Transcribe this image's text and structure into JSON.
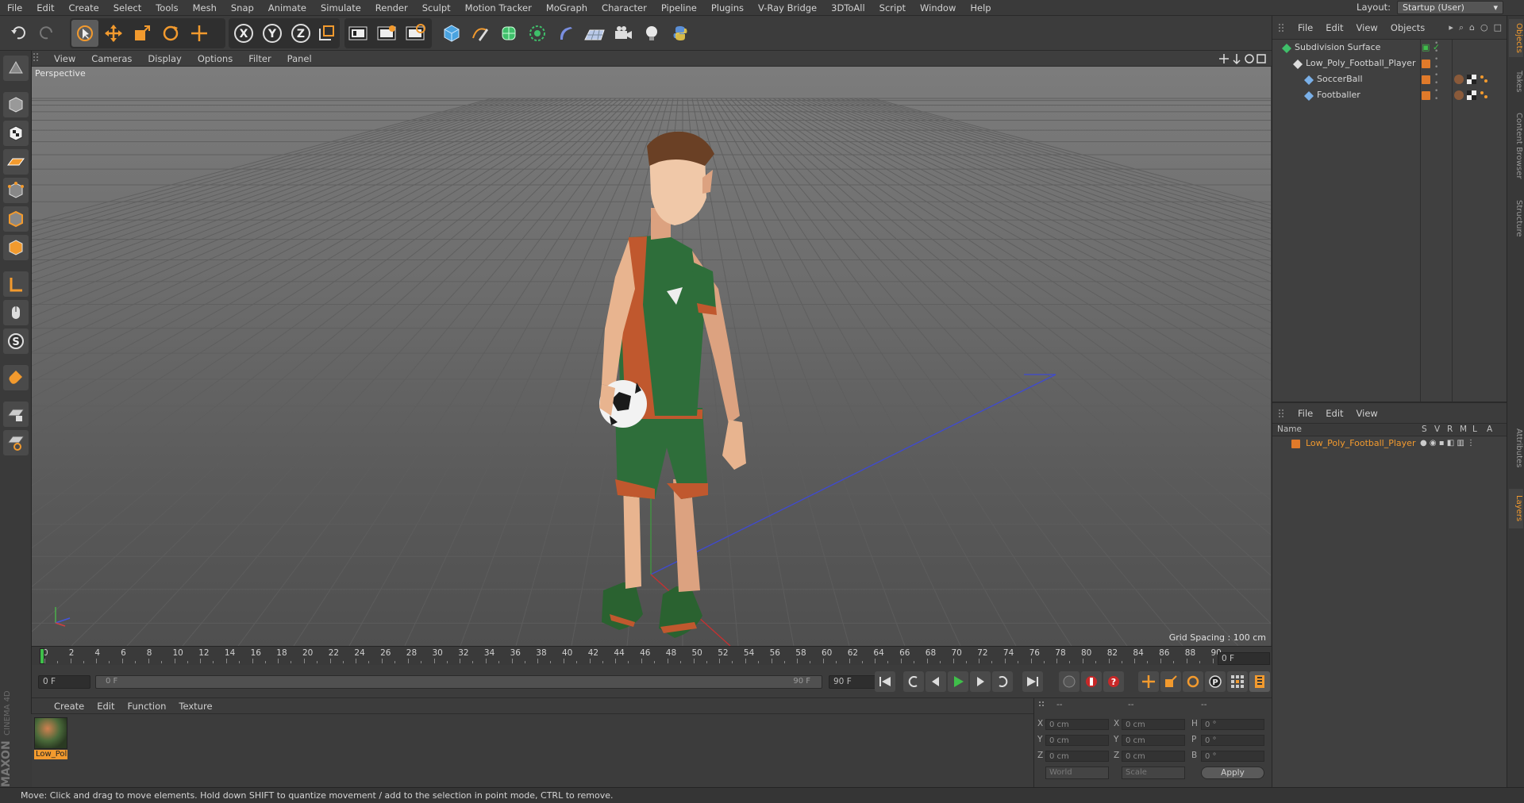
{
  "menubar": {
    "items": [
      "File",
      "Edit",
      "Create",
      "Select",
      "Tools",
      "Mesh",
      "Snap",
      "Animate",
      "Simulate",
      "Render",
      "Sculpt",
      "Motion Tracker",
      "MoGraph",
      "Character",
      "Pipeline",
      "Plugins",
      "V-Ray Bridge",
      "3DToAll",
      "Script",
      "Window",
      "Help"
    ],
    "layout_label": "Layout:",
    "layout_value": "Startup (User)"
  },
  "toolbar": {
    "icons": [
      "undo-icon",
      "redo-icon",
      "live-select-icon",
      "move-icon",
      "scale-icon",
      "rotate-icon",
      "recent-tool-icon",
      "x-axis-icon",
      "y-axis-icon",
      "z-axis-icon",
      "coordinate-system-icon",
      "render-view-icon",
      "render-picture-viewer-icon",
      "edit-render-settings-icon",
      "cube-icon",
      "pen-spline-icon",
      "subdivision-icon",
      "array-icon",
      "deformer-icon",
      "floor-icon",
      "camera-icon",
      "light-icon",
      "python-icon"
    ],
    "axis_labels": [
      "X",
      "Y",
      "Z"
    ]
  },
  "viewport": {
    "menu": [
      "View",
      "Cameras",
      "Display",
      "Options",
      "Filter",
      "Panel"
    ],
    "label": "Perspective",
    "grid_spacing": "Grid Spacing : 100 cm"
  },
  "timeline": {
    "ticks": [
      "0",
      "2",
      "4",
      "6",
      "8",
      "10",
      "12",
      "14",
      "16",
      "18",
      "20",
      "22",
      "24",
      "26",
      "28",
      "30",
      "32",
      "34",
      "36",
      "38",
      "40",
      "42",
      "44",
      "46",
      "48",
      "50",
      "52",
      "54",
      "56",
      "58",
      "60",
      "62",
      "64",
      "66",
      "68",
      "70",
      "72",
      "74",
      "76",
      "78",
      "80",
      "82",
      "84",
      "86",
      "88",
      "90"
    ],
    "current_frame": "0 F"
  },
  "transport": {
    "start_frame": "0 F",
    "slider_start": "0 F",
    "slider_end": "90 F",
    "end_frame": "90 F"
  },
  "material_panel": {
    "menu": [
      "Create",
      "Edit",
      "Function",
      "Texture"
    ],
    "material_name": "Low_Pol"
  },
  "coord_panel": {
    "headers": [
      "--",
      "--",
      "--"
    ],
    "pos_labels": [
      "X",
      "Y",
      "Z"
    ],
    "pos_values": [
      "0 cm",
      "0 cm",
      "0 cm"
    ],
    "size_labels": [
      "X",
      "Y",
      "Z"
    ],
    "size_values": [
      "0 cm",
      "0 cm",
      "0 cm"
    ],
    "rot_labels": [
      "H",
      "P",
      "B"
    ],
    "rot_values": [
      "0 °",
      "0 °",
      "0 °"
    ],
    "mode1": "World",
    "mode2": "Scale",
    "apply_label": "Apply"
  },
  "object_manager": {
    "menu": [
      "File",
      "Edit",
      "View",
      "Objects"
    ],
    "objects": [
      {
        "name": "Subdivision Surface",
        "level": 0
      },
      {
        "name": "Low_Poly_Football_Player",
        "level": 1
      },
      {
        "name": "SoccerBall",
        "level": 2
      },
      {
        "name": "Footballer",
        "level": 2
      }
    ]
  },
  "layer_manager": {
    "menu": [
      "File",
      "Edit",
      "View"
    ],
    "columns": [
      "Name",
      "S",
      "V",
      "R",
      "M",
      "L",
      "A"
    ],
    "layers": [
      {
        "name": "Low_Poly_Football_Player"
      }
    ]
  },
  "side_tabs": [
    "Objects",
    "Takes",
    "Content Browser",
    "Structure",
    "Attributes",
    "Layers"
  ],
  "status": "Move: Click and drag to move elements. Hold down SHIFT to quantize movement / add to the selection in point mode, CTRL to remove.",
  "brand": {
    "maxon": "MAXON",
    "cinema": "CINEMA 4D"
  },
  "colors": {
    "accent": "#f29a2e",
    "layer_orange": "#e07a2a",
    "jersey_green": "#2e6e3a",
    "jersey_orange": "#c0582e"
  }
}
